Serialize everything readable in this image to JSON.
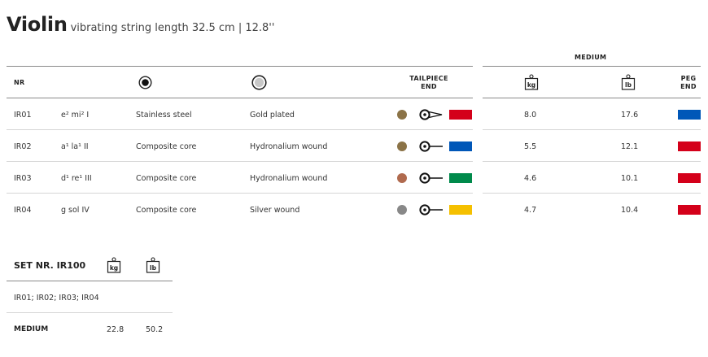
{
  "title": {
    "name": "Violin",
    "subtitle": "vibrating string length 32.5 cm | 12.8''"
  },
  "header": {
    "nr": "NR",
    "tailpiece_end_line1": "TAILPIECE",
    "tailpiece_end_line2": "END",
    "medium": "MEDIUM",
    "peg_end_line1": "PEG",
    "peg_end_line2": "END",
    "icons": {
      "core": "filled-circle-icon",
      "wrap": "grey-circle-icon",
      "kg": "kg-weight-icon",
      "lb": "lb-weight-icon"
    }
  },
  "units": {
    "kg": "kg",
    "lb": "lb"
  },
  "rows": [
    {
      "nr": "IR01",
      "note": "e² mi² I",
      "core": "Stainless steel",
      "wrap": "Gold plated",
      "dot_color": "#8b7347",
      "end_type": "loop-end-icon",
      "tail_color": "#d4001a",
      "kg": "8.0",
      "lb": "17.6",
      "peg_color": "#0057b8"
    },
    {
      "nr": "IR02",
      "note": "a¹ la¹ II",
      "core": "Composite core",
      "wrap": "Hydronalium wound",
      "dot_color": "#8b7347",
      "end_type": "ball-end-icon",
      "tail_color": "#0057b8",
      "kg": "5.5",
      "lb": "12.1",
      "peg_color": "#d4001a"
    },
    {
      "nr": "IR03",
      "note": "d¹ re¹ III",
      "core": "Composite core",
      "wrap": "Hydronalium wound",
      "dot_color": "#b06a4e",
      "end_type": "ball-end-icon",
      "tail_color": "#008a4b",
      "kg": "4.6",
      "lb": "10.1",
      "peg_color": "#d4001a"
    },
    {
      "nr": "IR04",
      "note": "g sol IV",
      "core": "Composite core",
      "wrap": "Silver wound",
      "dot_color": "#888888",
      "end_type": "ball-end-icon",
      "tail_color": "#f5c000",
      "kg": "4.7",
      "lb": "10.4",
      "peg_color": "#d4001a"
    }
  ],
  "set": {
    "label": "SET NR. IR100",
    "strings": "IR01; IR02; IR03; IR04",
    "tension_label": "MEDIUM",
    "kg": "22.8",
    "lb": "50.2"
  }
}
